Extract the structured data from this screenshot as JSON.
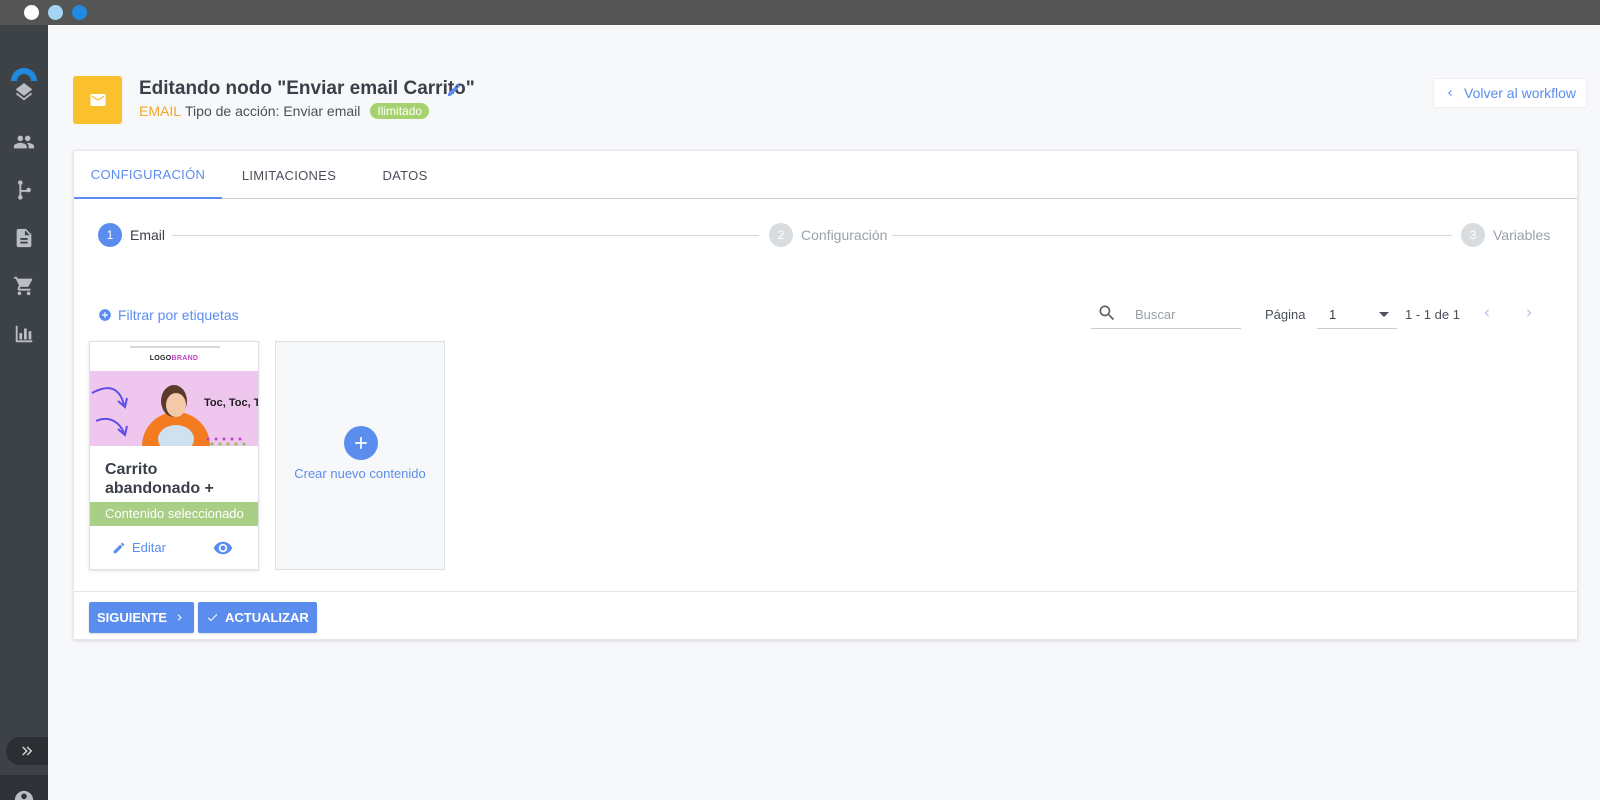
{
  "window": {
    "controls": [
      "close",
      "minimize",
      "maximize"
    ]
  },
  "sidebar": {
    "logo": "brand-arc-logo",
    "items": [
      {
        "name": "layers",
        "icon": "layers-icon"
      },
      {
        "name": "contacts",
        "icon": "people-icon"
      },
      {
        "name": "workflows",
        "icon": "workflow-icon"
      },
      {
        "name": "content",
        "icon": "document-icon"
      },
      {
        "name": "ecommerce",
        "icon": "cart-icon"
      },
      {
        "name": "reports",
        "icon": "bar-chart-icon"
      }
    ],
    "expand_icon": "double-chevron-right-icon",
    "account_icon": "account-circle-icon"
  },
  "header": {
    "title": "Editando nodo \"Enviar email Carrito\"",
    "channel": "EMAIL",
    "action_type": "Tipo de acción: Enviar email",
    "limit_badge": "Ilimitado",
    "back_label": "Volver al workflow"
  },
  "tabs": [
    {
      "label": "CONFIGURACIÓN",
      "active": true
    },
    {
      "label": "LIMITACIONES",
      "active": false
    },
    {
      "label": "DATOS",
      "active": false
    }
  ],
  "stepper": [
    {
      "num": "1",
      "label": "Email",
      "active": true
    },
    {
      "num": "2",
      "label": "Configuración",
      "active": false
    },
    {
      "num": "3",
      "label": "Variables",
      "active": false
    }
  ],
  "toolbar": {
    "filter_label": "Filtrar por etiquetas",
    "search_placeholder": "Buscar",
    "page_label": "Página",
    "page_value": "1",
    "range_label": "1 - 1 de 1"
  },
  "contents": [
    {
      "thumb_brand_1": "LOGO",
      "thumb_brand_2": "BRAND",
      "thumb_hero_text": "Toc, Toc, To",
      "title": "Carrito abandonado +",
      "status": "Contenido seleccionado",
      "edit_label": "Editar"
    }
  ],
  "new_content": {
    "label": "Crear nuevo contenido"
  },
  "footer": {
    "next_label": "SIGUIENTE",
    "update_label": "ACTUALIZAR"
  },
  "colors": {
    "accent": "#5b8def",
    "node_badge": "#fbc02d",
    "limit_badge": "#a5d16e",
    "selected_status": "#a9cf86",
    "sidebar": "#3d4247"
  }
}
